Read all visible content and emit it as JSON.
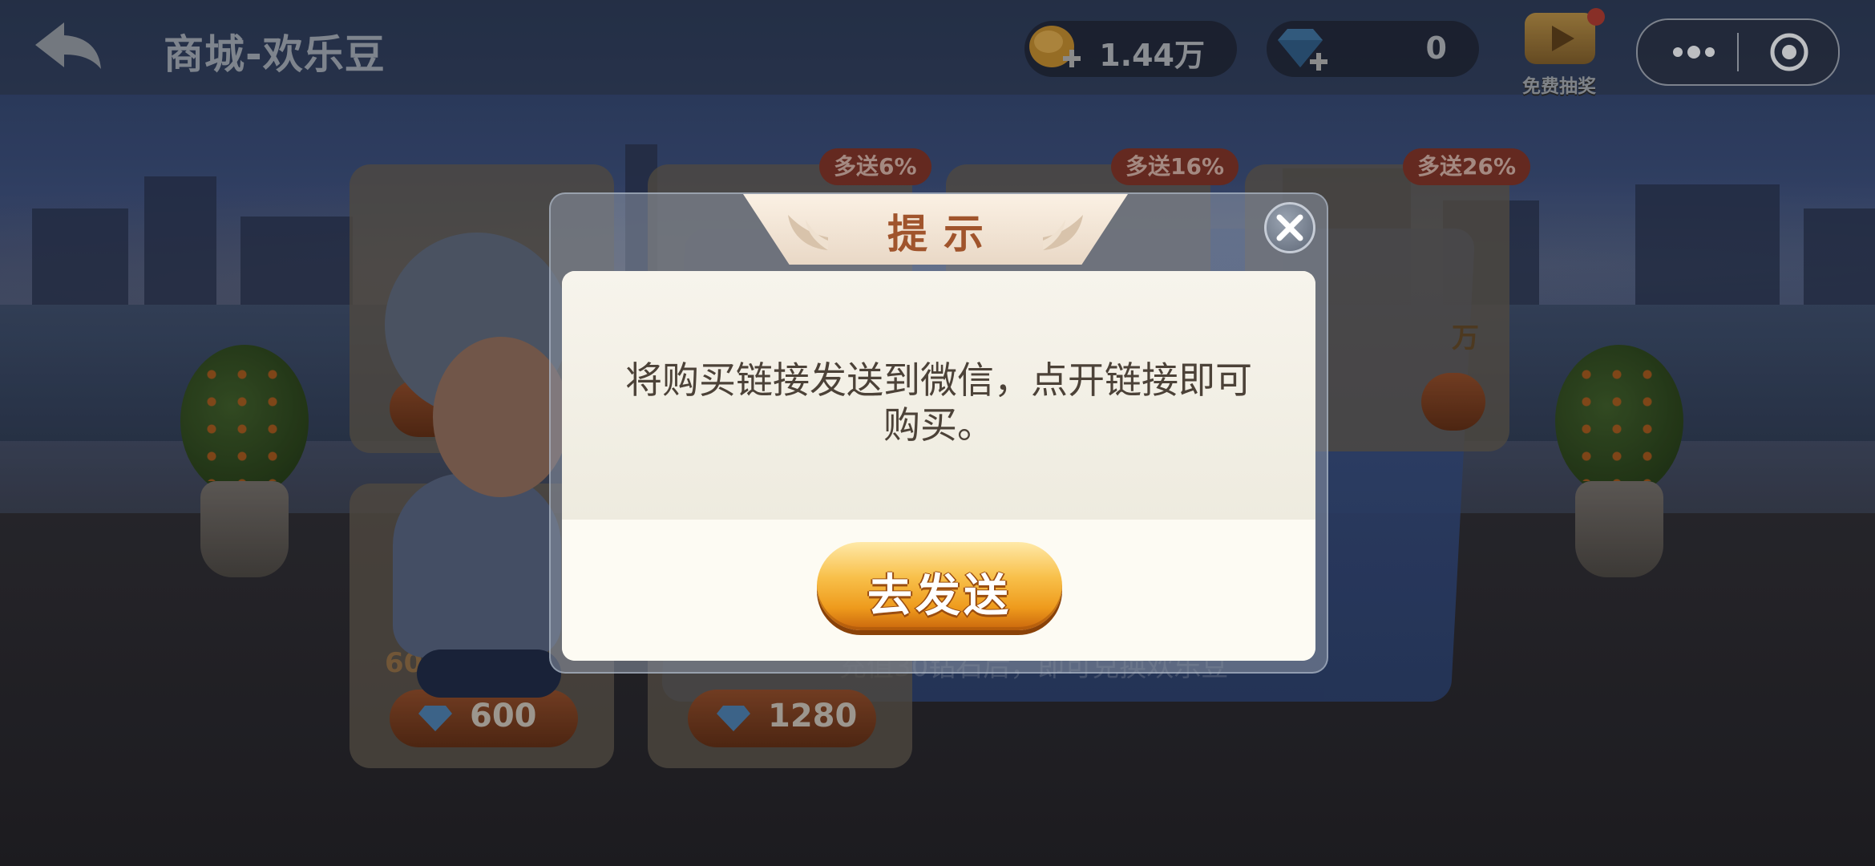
{
  "topbar": {
    "title": "商城-欢乐豆",
    "coins": {
      "value": "1.44万",
      "icon": "coin-add-icon"
    },
    "diamonds": {
      "value": "0",
      "icon": "diamond-add-icon"
    },
    "free_lottery_label": "免费抽奖"
  },
  "shop": {
    "badges": [
      "多送6%",
      "多送16%",
      "多送26%"
    ],
    "cards": [
      {
        "amount": "60万+21.6",
        "price": "600"
      },
      {
        "price": "1280"
      },
      {
        "amount": "万"
      }
    ],
    "note": "充值30钻石后，即可兑换欢乐豆"
  },
  "dialog": {
    "title": "提示",
    "message": "将购买链接发送到微信，点开链接即可购买。",
    "confirm_label": "去发送"
  },
  "colors": {
    "button_gradient_top": "#ffe9a8",
    "button_gradient_bottom": "#c9650c",
    "title_color": "#a0542c",
    "message_color": "#4c4238"
  }
}
